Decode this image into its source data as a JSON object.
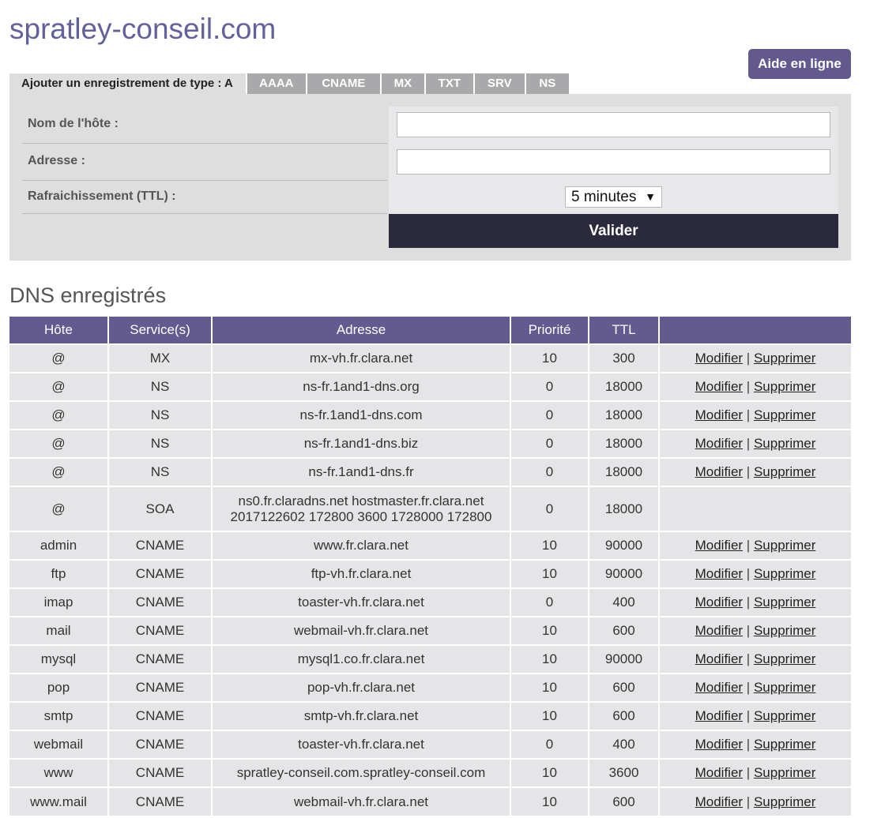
{
  "site": {
    "title": "spratley-conseil.com",
    "help_label": "Aide en ligne"
  },
  "tabs": [
    {
      "label": "Ajouter un enregistrement de type : A"
    },
    {
      "label": "AAAA"
    },
    {
      "label": "CNAME"
    },
    {
      "label": "MX"
    },
    {
      "label": "TXT"
    },
    {
      "label": "SRV"
    },
    {
      "label": "NS"
    }
  ],
  "form": {
    "host_label": "Nom de l'hôte :",
    "host_value": "",
    "address_label": "Adresse :",
    "address_value": "",
    "ttl_label": "Rafraichissement (TTL) :",
    "ttl_selected": "5 minutes",
    "submit_label": "Valider"
  },
  "records": {
    "title": "DNS enregistrés",
    "columns": [
      "Hôte",
      "Service(s)",
      "Adresse",
      "Priorité",
      "TTL",
      ""
    ],
    "modify_label": "Modifier",
    "delete_label": "Supprimer",
    "rows": [
      {
        "host": "@",
        "service": "MX",
        "address": "mx-vh.fr.clara.net",
        "priority": "10",
        "ttl": "300"
      },
      {
        "host": "@",
        "service": "NS",
        "address": "ns-fr.1and1-dns.org",
        "priority": "0",
        "ttl": "18000"
      },
      {
        "host": "@",
        "service": "NS",
        "address": "ns-fr.1and1-dns.com",
        "priority": "0",
        "ttl": "18000"
      },
      {
        "host": "@",
        "service": "NS",
        "address": "ns-fr.1and1-dns.biz",
        "priority": "0",
        "ttl": "18000"
      },
      {
        "host": "@",
        "service": "NS",
        "address": "ns-fr.1and1-dns.fr",
        "priority": "0",
        "ttl": "18000"
      },
      {
        "host": "@",
        "service": "SOA",
        "address": "ns0.fr.claradns.net hostmaster.fr.clara.net",
        "address_line2": "2017122602 172800 3600 1728000 172800",
        "priority": "0",
        "ttl": "18000"
      },
      {
        "host": "admin",
        "service": "CNAME",
        "address": "www.fr.clara.net",
        "priority": "10",
        "ttl": "90000"
      },
      {
        "host": "ftp",
        "service": "CNAME",
        "address": "ftp-vh.fr.clara.net",
        "priority": "10",
        "ttl": "90000"
      },
      {
        "host": "imap",
        "service": "CNAME",
        "address": "toaster-vh.fr.clara.net",
        "priority": "0",
        "ttl": "400"
      },
      {
        "host": "mail",
        "service": "CNAME",
        "address": "webmail-vh.fr.clara.net",
        "priority": "10",
        "ttl": "600"
      },
      {
        "host": "mysql",
        "service": "CNAME",
        "address": "mysql1.co.fr.clara.net",
        "priority": "10",
        "ttl": "90000"
      },
      {
        "host": "pop",
        "service": "CNAME",
        "address": "pop-vh.fr.clara.net",
        "priority": "10",
        "ttl": "600"
      },
      {
        "host": "smtp",
        "service": "CNAME",
        "address": "smtp-vh.fr.clara.net",
        "priority": "10",
        "ttl": "600"
      },
      {
        "host": "webmail",
        "service": "CNAME",
        "address": "toaster-vh.fr.clara.net",
        "priority": "0",
        "ttl": "400"
      },
      {
        "host": "www",
        "service": "CNAME",
        "address": "spratley-conseil.com.spratley-conseil.com",
        "priority": "10",
        "ttl": "3600"
      },
      {
        "host": "www.mail",
        "service": "CNAME",
        "address": "webmail-vh.fr.clara.net",
        "priority": "10",
        "ttl": "600"
      }
    ]
  }
}
